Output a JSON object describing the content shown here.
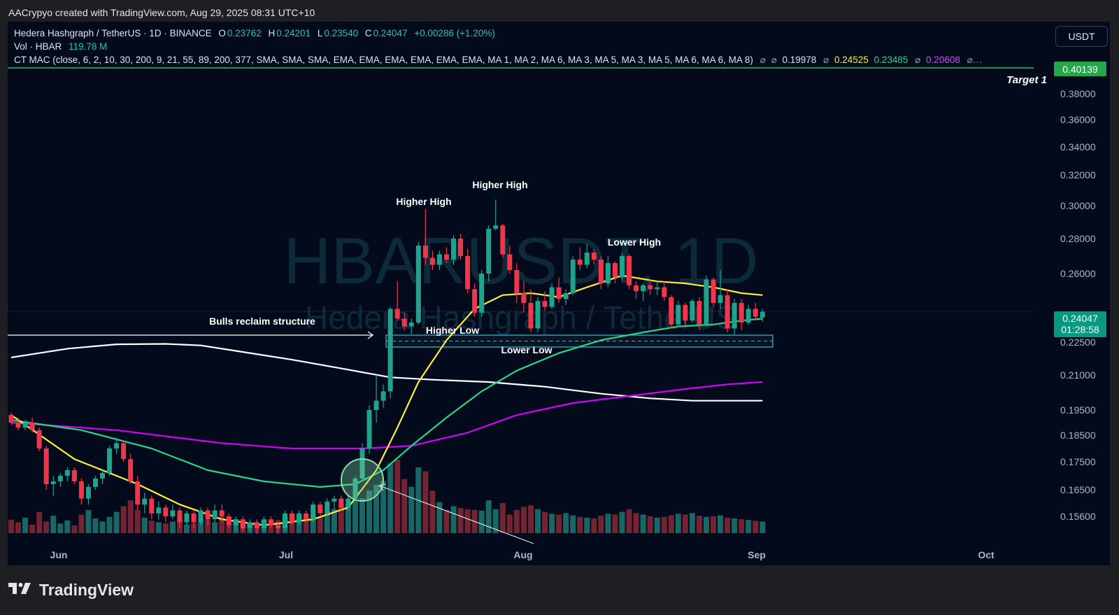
{
  "header": {
    "credit": "AACrypyo created with TradingView.com, Aug 29, 2025 08:31 UTC+10"
  },
  "legend": {
    "symbol": "Hedera Hashgraph / TetherUS · 1D · BINANCE",
    "o_label": "O",
    "o": "0.23762",
    "h_label": "H",
    "h": "0.24201",
    "l_label": "L",
    "l": "0.23540",
    "c_label": "C",
    "c": "0.24047",
    "change": "+0.00286 (+1.20%)",
    "vol_label": "Vol · HBAR",
    "vol": "119.78 M",
    "indicator": "CT MAC (close, 6, 2, 10, 30, 200, 9, 21, 55, 89, 200, 377, SMA, SMA, SMA, EMA, EMA, EMA, EMA, EMA, EMA, MA 1, MA 2, MA 6, MA 3, MA 5, MA 3, MA 5, MA 6, MA 6, MA 8)",
    "ind_values": [
      {
        "text": "0.19978",
        "color": "#ffffff"
      },
      {
        "text": "0.24525",
        "color": "#ffeb3b"
      },
      {
        "text": "0.23485",
        "color": "#26d68a"
      },
      {
        "text": "0.20608",
        "color": "#e040fb"
      }
    ],
    "null_symbol": "⌀",
    "ellipsis": "…"
  },
  "currency_button": "USDT",
  "watermark": {
    "main": "HBARUSDT, 1D",
    "sub": "Hedera Hashgraph / TetherUS"
  },
  "footer": {
    "brand": "TradingView",
    "logo_icon": "tradingview-logo-icon"
  },
  "colors": {
    "up": "#1fa38d",
    "down": "#f0364a",
    "ma_yellow": "#ffeb3b",
    "ma_green": "#26d68a",
    "ma_magenta": "#d500f9",
    "ma_white": "#ffffff",
    "accent": "#089981"
  },
  "chart_data": {
    "type": "candlestick",
    "x_ticks": [
      "Jun",
      "Jul",
      "Aug",
      "Sep",
      "Oct"
    ],
    "y_ticks": [
      "0.38000",
      "0.36000",
      "0.34000",
      "0.32000",
      "0.30000",
      "0.28000",
      "0.26000",
      "0.22500",
      "0.21000",
      "0.19500",
      "0.18500",
      "0.17500",
      "0.16500",
      "0.15600"
    ],
    "y_tick_values": [
      0.38,
      0.36,
      0.34,
      0.32,
      0.3,
      0.28,
      0.26,
      0.225,
      0.21,
      0.195,
      0.185,
      0.175,
      0.165,
      0.156
    ],
    "y_scale": "log",
    "price_label": {
      "value": "0.24047",
      "countdown": "01:28:58"
    },
    "target_label": {
      "value": "0.40139",
      "text": "Target 1"
    },
    "annotations": [
      "Bulls reclaim structure",
      "Higher High",
      "Higher High",
      "Higher Low",
      "Lower Low",
      "Lower High"
    ],
    "support_zone": [
      0.2225,
      0.2285
    ],
    "candles_ohlc": [
      [
        0.193,
        0.194,
        0.189,
        0.19
      ],
      [
        0.19,
        0.192,
        0.187,
        0.188
      ],
      [
        0.188,
        0.191,
        0.187,
        0.19
      ],
      [
        0.19,
        0.192,
        0.186,
        0.187
      ],
      [
        0.187,
        0.188,
        0.179,
        0.18
      ],
      [
        0.18,
        0.181,
        0.165,
        0.167
      ],
      [
        0.167,
        0.17,
        0.163,
        0.168
      ],
      [
        0.168,
        0.171,
        0.166,
        0.17
      ],
      [
        0.17,
        0.173,
        0.168,
        0.172
      ],
      [
        0.172,
        0.173,
        0.167,
        0.168
      ],
      [
        0.168,
        0.169,
        0.16,
        0.162
      ],
      [
        0.162,
        0.167,
        0.16,
        0.166
      ],
      [
        0.166,
        0.17,
        0.165,
        0.169
      ],
      [
        0.169,
        0.172,
        0.167,
        0.171
      ],
      [
        0.171,
        0.181,
        0.17,
        0.18
      ],
      [
        0.18,
        0.184,
        0.178,
        0.182
      ],
      [
        0.182,
        0.183,
        0.175,
        0.176
      ],
      [
        0.176,
        0.178,
        0.167,
        0.168
      ],
      [
        0.168,
        0.17,
        0.158,
        0.16
      ],
      [
        0.16,
        0.164,
        0.157,
        0.162
      ],
      [
        0.162,
        0.163,
        0.155,
        0.157
      ],
      [
        0.157,
        0.161,
        0.155,
        0.159
      ],
      [
        0.159,
        0.16,
        0.154,
        0.156
      ],
      [
        0.156,
        0.16,
        0.155,
        0.158
      ],
      [
        0.158,
        0.159,
        0.152,
        0.154
      ],
      [
        0.154,
        0.158,
        0.153,
        0.157
      ],
      [
        0.157,
        0.158,
        0.152,
        0.154
      ],
      [
        0.154,
        0.159,
        0.153,
        0.158
      ],
      [
        0.158,
        0.159,
        0.153,
        0.155
      ],
      [
        0.155,
        0.16,
        0.154,
        0.158
      ],
      [
        0.158,
        0.16,
        0.154,
        0.156
      ],
      [
        0.156,
        0.157,
        0.152,
        0.153
      ],
      [
        0.153,
        0.156,
        0.151,
        0.155
      ],
      [
        0.155,
        0.156,
        0.151,
        0.152
      ],
      [
        0.152,
        0.155,
        0.151,
        0.154
      ],
      [
        0.154,
        0.155,
        0.15,
        0.152
      ],
      [
        0.152,
        0.156,
        0.151,
        0.155
      ],
      [
        0.155,
        0.156,
        0.152,
        0.153
      ],
      [
        0.153,
        0.154,
        0.15,
        0.152
      ],
      [
        0.152,
        0.158,
        0.151,
        0.157
      ],
      [
        0.157,
        0.158,
        0.153,
        0.154
      ],
      [
        0.154,
        0.158,
        0.153,
        0.157
      ],
      [
        0.157,
        0.158,
        0.154,
        0.155
      ],
      [
        0.155,
        0.161,
        0.154,
        0.16
      ],
      [
        0.16,
        0.161,
        0.156,
        0.157
      ],
      [
        0.157,
        0.162,
        0.156,
        0.161
      ],
      [
        0.161,
        0.163,
        0.158,
        0.162
      ],
      [
        0.162,
        0.163,
        0.158,
        0.159
      ],
      [
        0.159,
        0.163,
        0.158,
        0.162
      ],
      [
        0.162,
        0.17,
        0.161,
        0.169
      ],
      [
        0.169,
        0.182,
        0.168,
        0.18
      ],
      [
        0.18,
        0.197,
        0.178,
        0.195
      ],
      [
        0.195,
        0.21,
        0.19,
        0.199
      ],
      [
        0.199,
        0.206,
        0.196,
        0.203
      ],
      [
        0.203,
        0.243,
        0.2,
        0.242
      ],
      [
        0.242,
        0.256,
        0.236,
        0.237
      ],
      [
        0.237,
        0.24,
        0.231,
        0.233
      ],
      [
        0.233,
        0.237,
        0.229,
        0.235
      ],
      [
        0.235,
        0.278,
        0.234,
        0.276
      ],
      [
        0.276,
        0.298,
        0.265,
        0.269
      ],
      [
        0.269,
        0.273,
        0.262,
        0.265
      ],
      [
        0.265,
        0.273,
        0.262,
        0.271
      ],
      [
        0.271,
        0.275,
        0.266,
        0.268
      ],
      [
        0.268,
        0.282,
        0.265,
        0.28
      ],
      [
        0.28,
        0.283,
        0.268,
        0.27
      ],
      [
        0.27,
        0.274,
        0.25,
        0.252
      ],
      [
        0.252,
        0.255,
        0.238,
        0.24
      ],
      [
        0.24,
        0.262,
        0.238,
        0.26
      ],
      [
        0.26,
        0.288,
        0.256,
        0.286
      ],
      [
        0.286,
        0.304,
        0.285,
        0.288
      ],
      [
        0.288,
        0.289,
        0.269,
        0.271
      ],
      [
        0.271,
        0.276,
        0.26,
        0.262
      ],
      [
        0.262,
        0.266,
        0.245,
        0.25
      ],
      [
        0.25,
        0.256,
        0.24,
        0.245
      ],
      [
        0.245,
        0.252,
        0.23,
        0.232
      ],
      [
        0.232,
        0.248,
        0.23,
        0.246
      ],
      [
        0.246,
        0.251,
        0.241,
        0.243
      ],
      [
        0.243,
        0.255,
        0.242,
        0.253
      ],
      [
        0.253,
        0.258,
        0.245,
        0.247
      ],
      [
        0.247,
        0.252,
        0.244,
        0.25
      ],
      [
        0.25,
        0.27,
        0.249,
        0.268
      ],
      [
        0.268,
        0.275,
        0.262,
        0.265
      ],
      [
        0.265,
        0.277,
        0.263,
        0.272
      ],
      [
        0.272,
        0.274,
        0.265,
        0.268
      ],
      [
        0.268,
        0.27,
        0.252,
        0.255
      ],
      [
        0.255,
        0.27,
        0.253,
        0.266
      ],
      [
        0.266,
        0.267,
        0.255,
        0.258
      ],
      [
        0.258,
        0.272,
        0.256,
        0.27
      ],
      [
        0.27,
        0.271,
        0.252,
        0.254
      ],
      [
        0.254,
        0.256,
        0.247,
        0.251
      ],
      [
        0.251,
        0.255,
        0.246,
        0.254
      ],
      [
        0.254,
        0.257,
        0.249,
        0.252
      ],
      [
        0.252,
        0.256,
        0.249,
        0.253
      ],
      [
        0.253,
        0.256,
        0.246,
        0.248
      ],
      [
        0.248,
        0.249,
        0.232,
        0.234
      ],
      [
        0.234,
        0.246,
        0.233,
        0.244
      ],
      [
        0.244,
        0.245,
        0.233,
        0.236
      ],
      [
        0.236,
        0.247,
        0.235,
        0.246
      ],
      [
        0.246,
        0.248,
        0.231,
        0.234
      ],
      [
        0.234,
        0.259,
        0.233,
        0.257
      ],
      [
        0.257,
        0.258,
        0.243,
        0.245
      ],
      [
        0.245,
        0.262,
        0.242,
        0.249
      ],
      [
        0.249,
        0.252,
        0.23,
        0.232
      ],
      [
        0.232,
        0.247,
        0.229,
        0.245
      ],
      [
        0.245,
        0.247,
        0.231,
        0.235
      ],
      [
        0.235,
        0.244,
        0.234,
        0.242
      ],
      [
        0.242,
        0.245,
        0.236,
        0.238
      ],
      [
        0.2376,
        0.242,
        0.2354,
        0.2405
      ]
    ],
    "volumes": [
      35,
      28,
      40,
      22,
      55,
      30,
      45,
      25,
      33,
      20,
      48,
      60,
      38,
      30,
      42,
      55,
      70,
      85,
      60,
      40,
      32,
      28,
      25,
      30,
      38,
      22,
      26,
      30,
      35,
      28,
      42,
      25,
      36,
      30,
      26,
      24,
      32,
      28,
      34,
      40,
      50,
      45,
      38,
      48,
      42,
      55,
      62,
      70,
      75,
      85,
      90,
      110,
      125,
      135,
      180,
      190,
      140,
      120,
      170,
      160,
      110,
      80,
      60,
      70,
      65,
      62,
      60,
      58,
      85,
      62,
      78,
      48,
      60,
      68,
      72,
      62,
      55,
      50,
      48,
      52,
      46,
      42,
      40,
      38,
      45,
      50,
      48,
      55,
      62,
      52,
      48,
      44,
      40,
      42,
      46,
      50,
      48,
      52,
      45,
      42,
      44,
      46,
      40,
      38,
      36,
      34,
      32,
      30
    ],
    "ma_yellow": [
      [
        0,
        0.193
      ],
      [
        9,
        0.176
      ],
      [
        18,
        0.167
      ],
      [
        24,
        0.16
      ],
      [
        30,
        0.155
      ],
      [
        36,
        0.153
      ],
      [
        43,
        0.155
      ],
      [
        48,
        0.159
      ],
      [
        52,
        0.172
      ],
      [
        55,
        0.188
      ],
      [
        58,
        0.207
      ],
      [
        62,
        0.226
      ],
      [
        66,
        0.242
      ],
      [
        70,
        0.249
      ],
      [
        74,
        0.25
      ],
      [
        78,
        0.248
      ],
      [
        82,
        0.253
      ],
      [
        87,
        0.259
      ],
      [
        92,
        0.256
      ],
      [
        96,
        0.255
      ],
      [
        100,
        0.253
      ],
      [
        104,
        0.25
      ],
      [
        107,
        0.249
      ]
    ],
    "ma_green": [
      [
        0,
        0.191
      ],
      [
        10,
        0.187
      ],
      [
        20,
        0.18
      ],
      [
        28,
        0.172
      ],
      [
        36,
        0.168
      ],
      [
        44,
        0.166
      ],
      [
        49,
        0.167
      ],
      [
        53,
        0.172
      ],
      [
        57,
        0.181
      ],
      [
        62,
        0.192
      ],
      [
        67,
        0.203
      ],
      [
        72,
        0.212
      ],
      [
        78,
        0.22
      ],
      [
        84,
        0.226
      ],
      [
        90,
        0.23
      ],
      [
        95,
        0.233
      ],
      [
        100,
        0.234
      ],
      [
        104,
        0.236
      ],
      [
        107,
        0.237
      ]
    ],
    "ma_magenta": [
      [
        0,
        0.19
      ],
      [
        15,
        0.187
      ],
      [
        30,
        0.182
      ],
      [
        40,
        0.18
      ],
      [
        50,
        0.18
      ],
      [
        57,
        0.181
      ],
      [
        65,
        0.186
      ],
      [
        72,
        0.193
      ],
      [
        80,
        0.198
      ],
      [
        88,
        0.201
      ],
      [
        96,
        0.204
      ],
      [
        102,
        0.206
      ],
      [
        107,
        0.207
      ]
    ],
    "ma_white": [
      [
        0,
        0.218
      ],
      [
        8,
        0.222
      ],
      [
        15,
        0.224
      ],
      [
        22,
        0.2242
      ],
      [
        27,
        0.2235
      ],
      [
        32,
        0.221
      ],
      [
        40,
        0.217
      ],
      [
        47,
        0.213
      ],
      [
        54,
        0.209
      ],
      [
        60,
        0.208
      ],
      [
        68,
        0.207
      ],
      [
        76,
        0.205
      ],
      [
        84,
        0.202
      ],
      [
        91,
        0.2
      ],
      [
        97,
        0.199
      ],
      [
        103,
        0.199
      ],
      [
        107,
        0.199
      ]
    ]
  }
}
